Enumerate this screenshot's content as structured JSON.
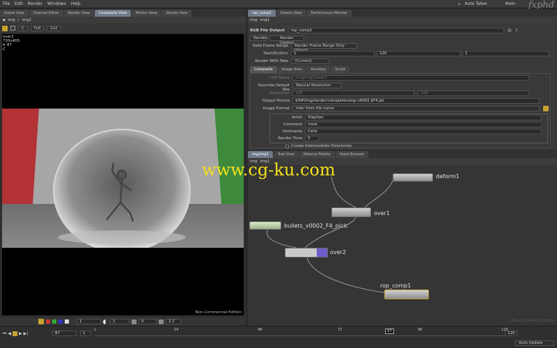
{
  "menu": [
    "File",
    "Edit",
    "Render",
    "Windows",
    "Help"
  ],
  "menu_right": {
    "auto_takes": "Auto Takes",
    "user": "Main"
  },
  "brand": "fxphd",
  "left_tabs": [
    "Scene View",
    "Channel Editor",
    "Render View",
    "Composite View",
    "Motion View",
    "Details View"
  ],
  "left_path": {
    "back": "◀",
    "sep": "/",
    "obj": "img",
    "node": "img1"
  },
  "viewer_tools": {
    "c": "C",
    "full": "Full",
    "two": "2x2"
  },
  "viewer_info": [
    "over2",
    "720x405",
    "fr 87",
    "C"
  ],
  "viewer_footer": "Non-Commercial Edition",
  "viewer_bottom": {
    "frame1": "1",
    "frame2": "1",
    "val3": "0",
    "val4": "2.2"
  },
  "watermark": "www.cg-ku.com",
  "param_tabs": [
    "rop_comp1",
    "Details View",
    "Performance Monitor"
  ],
  "param_path": {
    "obj": "img",
    "node": "img1"
  },
  "rop": {
    "type": "RGB File Output",
    "name": "rop_comp1"
  },
  "rop_buttons": [
    "Render",
    "Render Control"
  ],
  "params": {
    "valid_frame_range_label": "Valid Frame Range",
    "valid_frame_range_value": "Render Frame Range Only (Strict)",
    "start_end_label": "Start/End/Inc",
    "start": "1",
    "end": "120",
    "inc": "1",
    "render_with_take_label": "Render With Take",
    "render_with_take_value": "(Current)"
  },
  "sub_tabs": [
    "Composite",
    "Image Area",
    "Auxiliary",
    "Script"
  ],
  "composite": {
    "cop_name_label": "COP Name",
    "cop_name_value": "/img/img1/over2",
    "override_label": "Override Default Res",
    "override_value": "Natural Resolution",
    "resolution_label": "Resolution",
    "res_w": "128",
    "res_h": "100",
    "output_label": "Output Picture",
    "output_value": "$HIP/img/render/completecomp.v0002.$F4.pic",
    "format_label": "Image Format",
    "format_value": "Infer from file name",
    "artist_label": "Artist",
    "artist_value": "Stephen",
    "comment_label": "Comment",
    "comment_value": "none",
    "hostname_label": "Hostname",
    "hostname_value": "Celia",
    "rendertime_label": "Render Time",
    "rendertime_value": "0",
    "intermediate_label": "Create Intermediate Directories"
  },
  "net_tabs": [
    "img/img1",
    "Tree View",
    "Material Palette",
    "Asset Browser"
  ],
  "net_path": {
    "obj": "img",
    "node": "img1"
  },
  "nodes": {
    "deform": "deform1",
    "over1": "over1",
    "bullets": "bullets_v0002_F4_piclc",
    "over2": "over2",
    "rop": "rop_comp1"
  },
  "net_hint": "Non-Commercial Edition",
  "timeline": {
    "ticks": [
      "1",
      "24",
      "48",
      "72",
      "96",
      "120"
    ],
    "current": "87",
    "frame": "87",
    "start": "1",
    "end": "120",
    "auto_update": "Auto Update"
  }
}
